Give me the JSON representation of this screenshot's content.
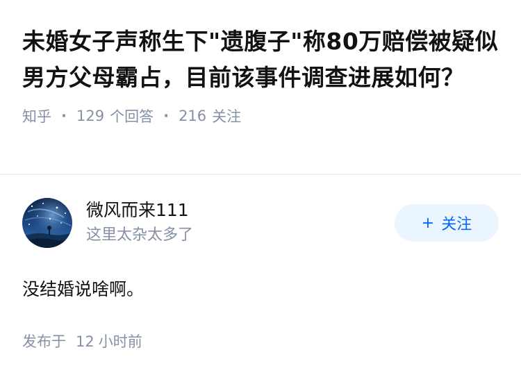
{
  "question": {
    "title": "未婚女子声称生下\"遗腹子\"称80万赔偿被疑似男方父母霸占，目前该事件调查进展如何？",
    "source": "知乎",
    "answer_count": "129",
    "answer_label": "个回答",
    "follower_count": "216",
    "follower_label": "关注"
  },
  "answer": {
    "author_name": "微风而来111",
    "author_bio": "这里太杂太多了",
    "follow_button": {
      "plus": "+",
      "label": "关注"
    },
    "content": "没结婚说啥啊。",
    "published_prefix": "发布于",
    "published_value": "12",
    "published_unit": "小时前"
  },
  "colors": {
    "title": "#121212",
    "meta": "#8590a6",
    "accent": "#0066ff",
    "follow_bg": "#ebf5ff",
    "divider": "#f2f2f2"
  },
  "icons": {
    "avatar": "starry-night-avatar"
  }
}
